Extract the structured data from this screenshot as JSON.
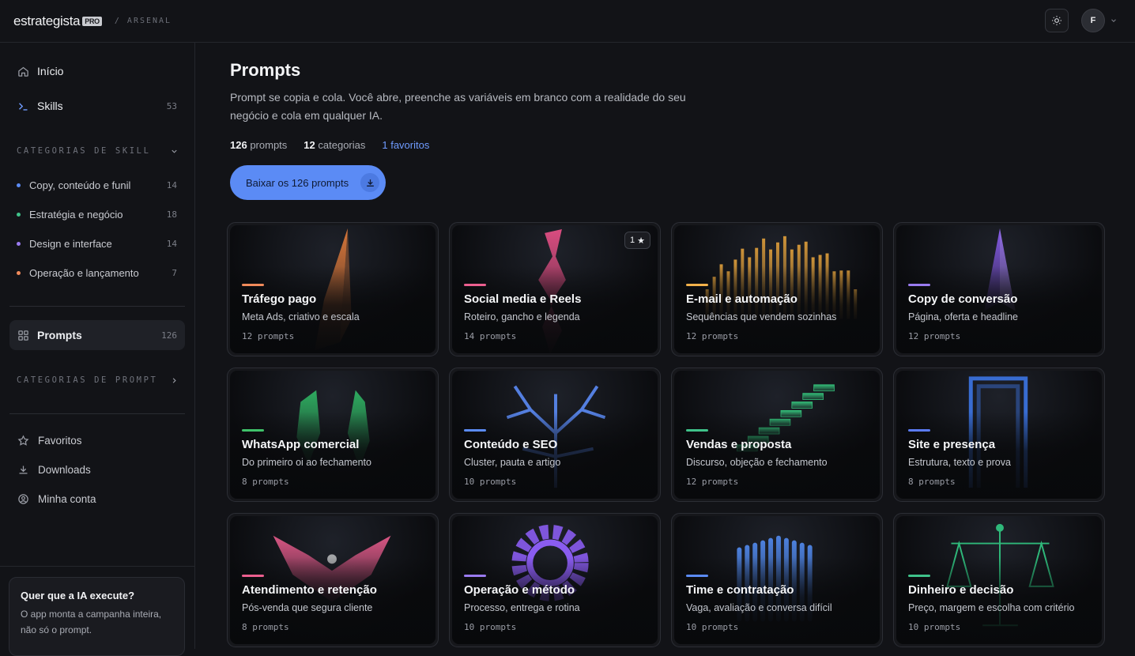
{
  "header": {
    "logo": "estrategista",
    "logo_badge": "PRO",
    "breadcrumb": "/ ARSENAL",
    "theme_icon": "sun-icon",
    "avatar_initial": "F"
  },
  "sidebar": {
    "main_items": [
      {
        "label": "Início",
        "icon": "home-icon"
      },
      {
        "label": "Skills",
        "icon": "terminal-icon",
        "count": "53"
      }
    ],
    "skill_section_title": "CATEGORIAS DE SKILL",
    "skill_categories": [
      {
        "label": "Copy, conteúdo e funil",
        "count": "14",
        "color": "#5b8bf5"
      },
      {
        "label": "Estratégia e negócio",
        "count": "18",
        "color": "#3fc28a"
      },
      {
        "label": "Design e interface",
        "count": "14",
        "color": "#9a7bf0"
      },
      {
        "label": "Operação e lançamento",
        "count": "7",
        "color": "#f08a5b"
      }
    ],
    "prompts_item": {
      "label": "Prompts",
      "count": "126",
      "icon": "grid-icon"
    },
    "prompt_section_title": "CATEGORIAS DE PROMPT",
    "sub_items": [
      {
        "label": "Favoritos",
        "icon": "star-icon"
      },
      {
        "label": "Downloads",
        "icon": "download-icon"
      },
      {
        "label": "Minha conta",
        "icon": "user-circle-icon"
      }
    ],
    "promo": {
      "title": "Quer que a IA execute?",
      "text": "O app monta a campanha inteira, não só o prompt."
    }
  },
  "main": {
    "title": "Prompts",
    "description": "Prompt se copia e cola. Você abre, preenche as variáveis em branco com a realidade do seu negócio e cola em qualquer IA.",
    "stats": {
      "prompts_num": "126",
      "prompts_label": "prompts",
      "categories_num": "12",
      "categories_label": "categorias",
      "favorites": "1 favoritos"
    },
    "download_button": "Baixar os 126 prompts",
    "cards": [
      {
        "title": "Tráfego pago",
        "subtitle": "Meta Ads, criativo e escala",
        "count": "12 prompts",
        "accent": "#f08a5b",
        "art": "shard",
        "tint": "#e07a3a"
      },
      {
        "title": "Social media e Reels",
        "subtitle": "Roteiro, gancho e legenda",
        "count": "14 prompts",
        "accent": "#ec5f8f",
        "art": "ribbon",
        "tint": "#e44f85",
        "badge": "1"
      },
      {
        "title": "E-mail e automação",
        "subtitle": "Sequências que vendem sozinhas",
        "count": "12 prompts",
        "accent": "#f2b14a",
        "art": "bars",
        "tint": "#d89a3a"
      },
      {
        "title": "Copy de conversão",
        "subtitle": "Página, oferta e headline",
        "count": "12 prompts",
        "accent": "#9a7bf0",
        "art": "spike",
        "tint": "#8a5cf0"
      },
      {
        "title": "WhatsApp comercial",
        "subtitle": "Do primeiro oi ao fechamento",
        "count": "8 prompts",
        "accent": "#3fc26a",
        "art": "crystals",
        "tint": "#2fb463"
      },
      {
        "title": "Conteúdo e SEO",
        "subtitle": "Cluster, pauta e artigo",
        "count": "10 prompts",
        "accent": "#5b8bf5",
        "art": "tree",
        "tint": "#5b8bf5"
      },
      {
        "title": "Vendas e proposta",
        "subtitle": "Discurso, objeção e fechamento",
        "count": "12 prompts",
        "accent": "#3fc28a",
        "art": "stairs",
        "tint": "#34c07a"
      },
      {
        "title": "Site e presença",
        "subtitle": "Estrutura, texto e prova",
        "count": "8 prompts",
        "accent": "#5b7bf5",
        "art": "frame",
        "tint": "#3f7bf0"
      },
      {
        "title": "Atendimento e retenção",
        "subtitle": "Pós-venda que segura cliente",
        "count": "8 prompts",
        "accent": "#ec5f8f",
        "art": "bowl",
        "tint": "#e45a8a"
      },
      {
        "title": "Operação e método",
        "subtitle": "Processo, entrega e rotina",
        "count": "10 prompts",
        "accent": "#9a7bf0",
        "art": "gear",
        "tint": "#8a5cf0"
      },
      {
        "title": "Time e contratação",
        "subtitle": "Vaga, avaliação e conversa difícil",
        "count": "10 prompts",
        "accent": "#5b8bf5",
        "art": "columns",
        "tint": "#4f86e8"
      },
      {
        "title": "Dinheiro e decisão",
        "subtitle": "Preço, margem e escolha com critério",
        "count": "10 prompts",
        "accent": "#3fc28a",
        "art": "scale",
        "tint": "#2fb87a"
      }
    ]
  }
}
